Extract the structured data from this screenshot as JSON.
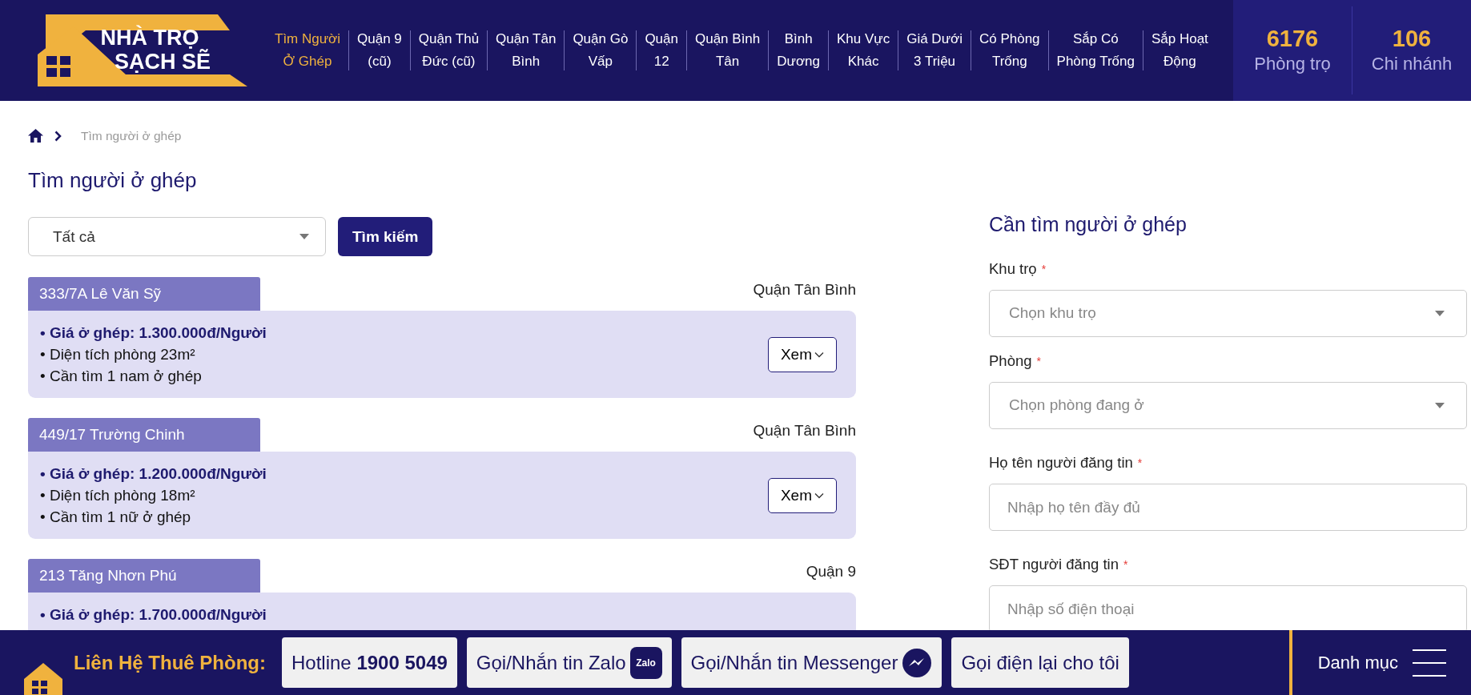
{
  "header": {
    "logo": {
      "line1": "NHÀ TRỌ",
      "line2": "SẠCH SẼ"
    },
    "nav": [
      {
        "label": "Tìm Người\nỞ Ghép",
        "selected": true
      },
      {
        "label": "Quận 9\n(cũ)",
        "selected": false
      },
      {
        "label": "Quận Thủ\nĐức (cũ)",
        "selected": false
      },
      {
        "label": "Quận Tân\nBình",
        "selected": false
      },
      {
        "label": "Quận Gò\nVấp",
        "selected": false
      },
      {
        "label": "Quận\n12",
        "selected": false
      },
      {
        "label": "Quận Bình\nTân",
        "selected": false
      },
      {
        "label": "Bình\nDương",
        "selected": false
      },
      {
        "label": "Khu Vực\nKhác",
        "selected": false
      },
      {
        "label": "Giá Dưới\n3 Triệu",
        "selected": false
      },
      {
        "label": "Có Phòng\nTrống",
        "selected": false
      },
      {
        "label": "Sắp Có\nPhòng Trống",
        "selected": false
      },
      {
        "label": "Sắp Hoạt\nĐộng",
        "selected": false
      }
    ],
    "stats": [
      {
        "value": "6176",
        "label": "Phòng trọ"
      },
      {
        "value": "106",
        "label": "Chi nhánh"
      }
    ]
  },
  "breadcrumb": {
    "current": "Tìm người ở ghép"
  },
  "page_title": "Tìm người ở ghép",
  "filter": {
    "value": "Tất cả",
    "button": "Tìm kiếm"
  },
  "listings": [
    {
      "address": "333/7A Lê Văn Sỹ",
      "district": "Quận Tân Bình",
      "lines": [
        "• Giá ở ghép: 1.300.000đ/Người",
        "• Diện tích phòng 23m²",
        "• Cần tìm 1 nam ở ghép"
      ],
      "button": "Xem"
    },
    {
      "address": "449/17 Trường Chinh",
      "district": "Quận Tân Bình",
      "lines": [
        "• Giá ở ghép: 1.200.000đ/Người",
        "• Diện tích phòng 18m²",
        "• Cần tìm 1 nữ ở ghép"
      ],
      "button": "Xem"
    },
    {
      "address": "213 Tăng Nhơn Phú",
      "district": "Quận 9",
      "lines": [
        "• Giá ở ghép: 1.700.000đ/Người"
      ]
    }
  ],
  "form": {
    "title": "Cần tìm người ở ghép",
    "required_mark": "*",
    "fields": [
      {
        "kind": "select",
        "label": "Khu trọ",
        "placeholder": "Chọn khu trọ"
      },
      {
        "kind": "select",
        "label": "Phòng",
        "placeholder": "Chọn phòng đang ở"
      },
      {
        "kind": "text",
        "label": "Họ tên người đăng tin",
        "placeholder": "Nhập họ tên đầy đủ"
      },
      {
        "kind": "text",
        "label": "SĐT người đăng tin",
        "placeholder": "Nhập số điện thoại"
      }
    ]
  },
  "footer": {
    "label": "Liên Hệ Thuê Phòng:",
    "buttons": [
      {
        "kind": "plain",
        "label": "Hotline **1900 5049**"
      },
      {
        "kind": "zalo",
        "label": "Gọi/Nhắn tin Zalo",
        "icon_text": "Zalo"
      },
      {
        "kind": "messenger",
        "label": "Gọi/Nhắn tin Messenger"
      },
      {
        "kind": "plain",
        "label": "Gọi điện lại cho tôi"
      }
    ],
    "menu": "Danh mục"
  }
}
